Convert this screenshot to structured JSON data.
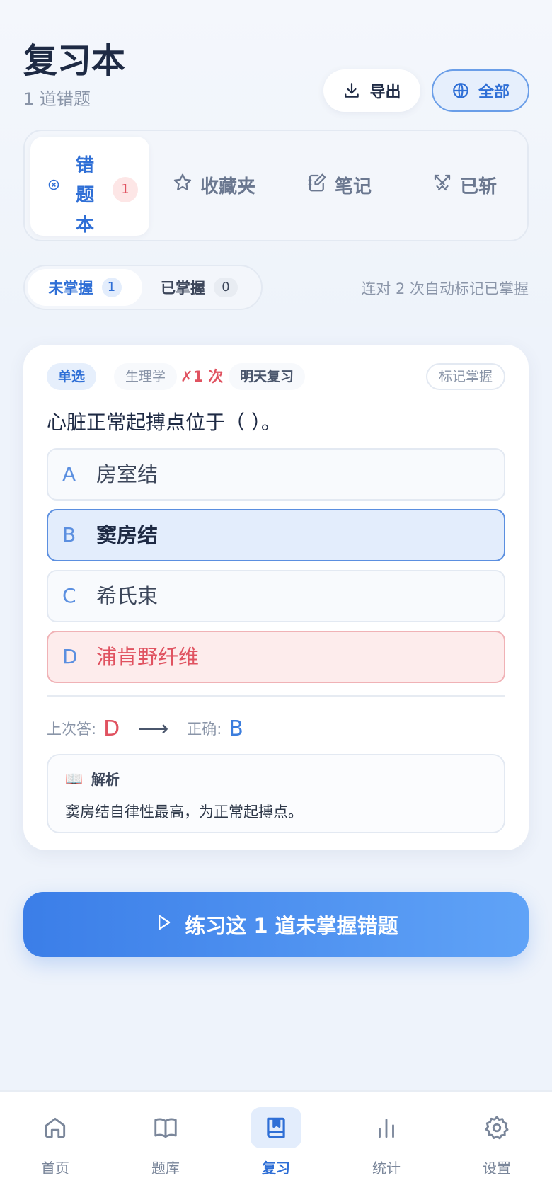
{
  "header": {
    "title": "复习本",
    "subtitle": "1 道错题",
    "export_label": "导出",
    "all_label": "全部"
  },
  "tabs": {
    "active": {
      "label": [
        "错",
        "题",
        "本"
      ],
      "badge": "1"
    },
    "favorites": "收藏夹",
    "notes": "笔记",
    "done": "已斩"
  },
  "filter": {
    "unmastered_label": "未掌握",
    "unmastered_count": "1",
    "mastered_label": "已掌握",
    "mastered_count": "0",
    "hint": "连对 2 次自动标记已掌握"
  },
  "card": {
    "tag_type": "单选",
    "tag_subject": "生理学",
    "tag_wrong": "✗1 次",
    "tag_next": "明天复习",
    "mark_button": "标记掌握",
    "question": "心脏正常起搏点位于（ ）。",
    "options": [
      {
        "letter": "A",
        "text": "房室结"
      },
      {
        "letter": "B",
        "text": "窦房结"
      },
      {
        "letter": "C",
        "text": "希氏束"
      },
      {
        "letter": "D",
        "text": "浦肯野纤维"
      }
    ],
    "last_answer_label": "上次答:",
    "last_answer": "D",
    "arrow": "⟶",
    "correct_label": "正确:",
    "correct_answer": "B",
    "explain_title": "解析",
    "explain_icon": "📖",
    "explain_text": "窦房结自律性最高，为正常起搏点。"
  },
  "practice_label": "练习这 1 道未掌握错题",
  "nav": [
    {
      "label": "首页",
      "icon": "home-icon"
    },
    {
      "label": "题库",
      "icon": "book-icon"
    },
    {
      "label": "复习",
      "icon": "bookmark-book-icon"
    },
    {
      "label": "统计",
      "icon": "bar-chart-icon"
    },
    {
      "label": "设置",
      "icon": "gear-icon"
    }
  ],
  "colors": {
    "accent": "#2f6fd6",
    "error": "#e05260",
    "background": "#eef3fb"
  }
}
